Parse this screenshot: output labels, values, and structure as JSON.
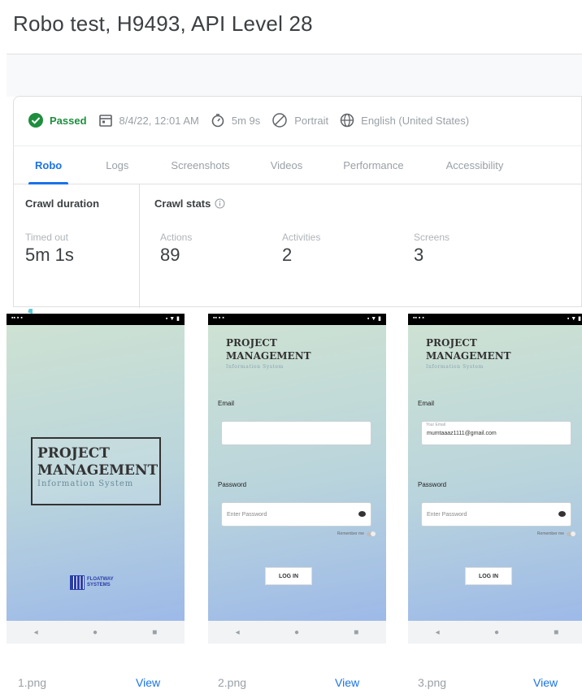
{
  "header": {
    "title": "Robo test, H9493, API Level 28"
  },
  "status": {
    "result": "Passed",
    "datetime": "8/4/22, 12:01 AM",
    "duration": "5m 9s",
    "orientation": "Portrait",
    "locale": "English (United States)"
  },
  "tabs": [
    "Robo",
    "Logs",
    "Screenshots",
    "Videos",
    "Performance",
    "Accessibility"
  ],
  "crawl_duration": {
    "heading": "Crawl duration",
    "label": "Timed out",
    "value": "5m 1s"
  },
  "crawl_stats": {
    "heading": "Crawl stats",
    "items": [
      {
        "label": "Actions",
        "value": "89"
      },
      {
        "label": "Activities",
        "value": "2"
      },
      {
        "label": "Screens",
        "value": "3"
      }
    ]
  },
  "screenshots": [
    {
      "file": "1.png",
      "view_label": "View"
    },
    {
      "file": "2.png",
      "view_label": "View"
    },
    {
      "file": "3.png",
      "view_label": "View"
    }
  ],
  "app": {
    "title_line1": "PROJECT",
    "title_line2": "MANAGEMENT",
    "subtitle": "Information System",
    "logo_line1": "FLOATWAY",
    "logo_line2": "SYSTEMS",
    "email_label": "Email",
    "email_floating": "Your Email",
    "email_value": "mumtaaaz1111@gmail.com",
    "password_label": "Password",
    "password_placeholder": "Enter Password",
    "remember_label": "Remember me",
    "login_label": "LOG IN"
  },
  "colors": {
    "accent": "#1a73e8",
    "passed": "#1e8e3e"
  }
}
